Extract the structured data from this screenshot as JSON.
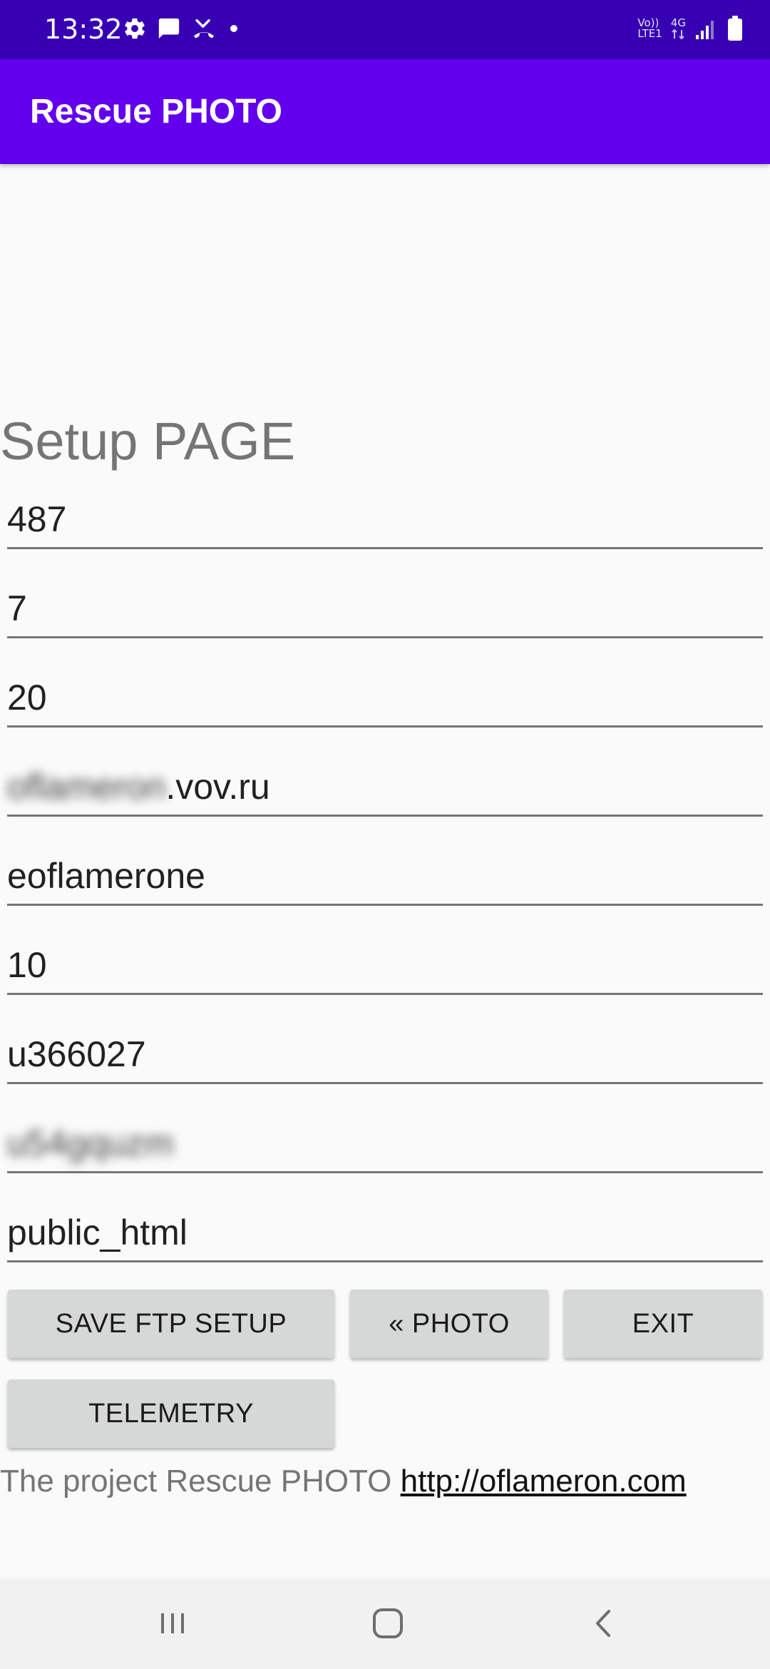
{
  "status_bar": {
    "time": "13:32",
    "volte_label": "Vo))",
    "lte_label": "LTE1",
    "network_label": "4G",
    "icons_left": [
      "gear-icon",
      "message-icon",
      "missed-call-icon",
      "dot-icon"
    ],
    "icons_right": [
      "volte-icon",
      "network-4g-icon",
      "signal-icon",
      "battery-icon"
    ]
  },
  "app_bar": {
    "title": "Rescue PHOTO"
  },
  "page": {
    "title": "Setup PAGE"
  },
  "fields": {
    "field_1": "487",
    "field_2": "7",
    "field_3": "20",
    "host_blurred_prefix": "oflameron",
    "host_suffix": ".vov.ru",
    "field_5": "eoflamerone",
    "field_6": "10",
    "field_7": "u366027",
    "password_blurred": "u54gquzm",
    "field_9": "public_html"
  },
  "buttons": {
    "save_ftp_setup": "SAVE FTP SETUP",
    "photo": "« PHOTO",
    "exit": "EXIT",
    "telemetry": "TELEMETRY"
  },
  "footer": {
    "text": "The project Rescue PHOTO ",
    "link": "http://oflameron.com"
  },
  "nav_bar": {
    "icons": [
      "recents-icon",
      "home-icon",
      "back-icon"
    ]
  },
  "colors": {
    "status_bar": "#3700b3",
    "app_bar": "#6200ee",
    "background": "#fafafa",
    "button": "#d6d7d7",
    "nav_bar": "#f1f1f1"
  }
}
